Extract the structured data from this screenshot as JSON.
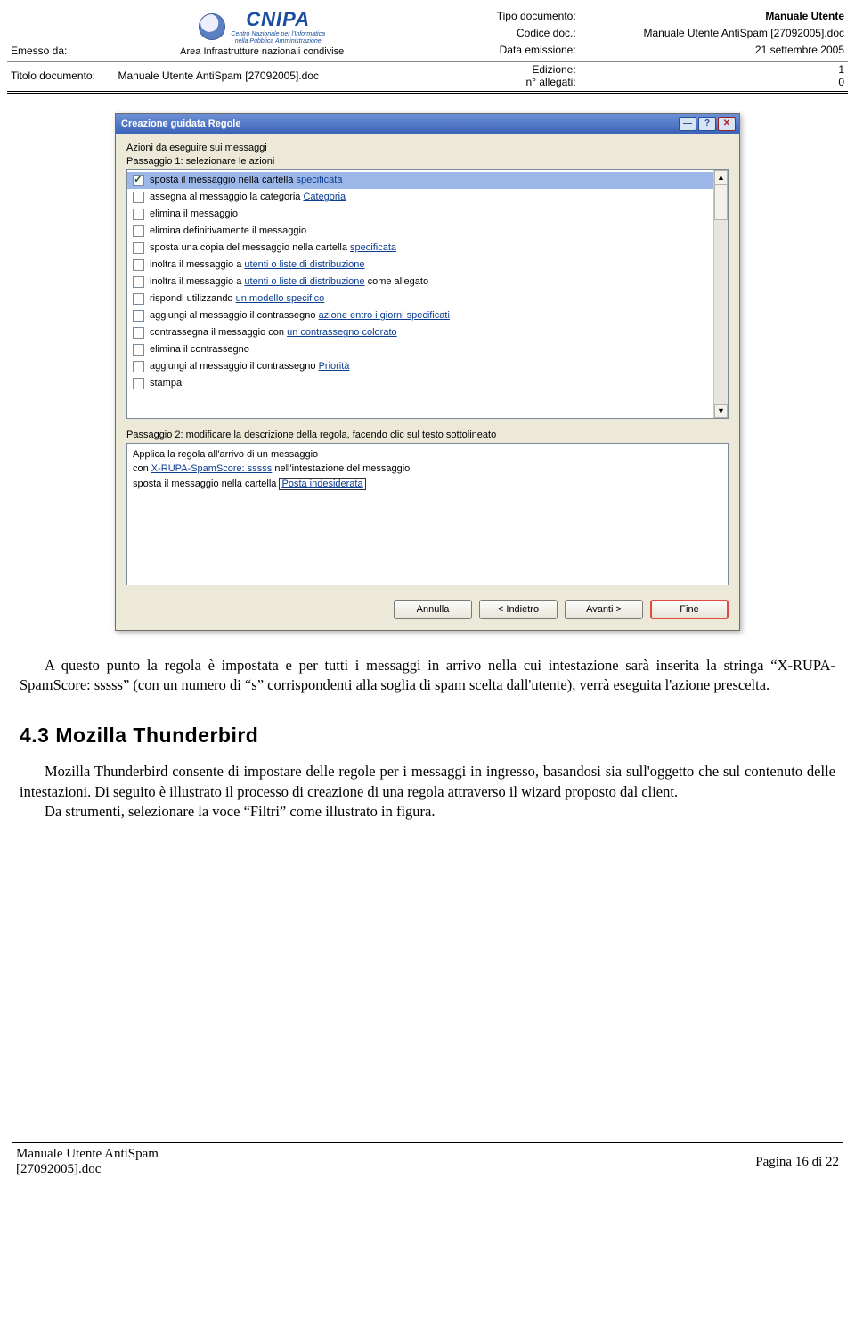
{
  "header": {
    "emesso_label": "Emesso da:",
    "logo_title": "CNIPA",
    "logo_sub1": "Centro Nazionale per l'Informatica",
    "logo_sub2": "nella Pubblica Amministrazione",
    "area_label": "Area Infrastrutture nazionali condivise",
    "tipo_label": "Tipo documento:",
    "codice_label": "Codice doc.:",
    "data_label": "Data emissione:",
    "tipo_value": "Manuale Utente",
    "codice_value": "Manuale Utente AntiSpam [27092005].doc",
    "data_value": "21 settembre 2005",
    "titolo_label": "Titolo documento:",
    "titolo_value": "Manuale Utente AntiSpam [27092005].doc",
    "edizione_label": "Edizione:",
    "allegati_label": "n° allegati:",
    "edizione_value": "1",
    "allegati_value": "0"
  },
  "dialog": {
    "title": "Creazione guidata Regole",
    "section_label": "Azioni da eseguire sui messaggi",
    "step1_label": "Passaggio 1: selezionare le azioni",
    "items": [
      {
        "pre": "sposta il messaggio nella cartella ",
        "link": "specificata",
        "post": "",
        "checked": true,
        "selected": true
      },
      {
        "pre": "assegna al messaggio la categoria ",
        "link": "Categoria",
        "post": "",
        "checked": false
      },
      {
        "pre": "elimina il messaggio",
        "link": "",
        "post": "",
        "checked": false
      },
      {
        "pre": "elimina definitivamente il messaggio",
        "link": "",
        "post": "",
        "checked": false
      },
      {
        "pre": "sposta una copia del messaggio nella cartella ",
        "link": "specificata",
        "post": "",
        "checked": false
      },
      {
        "pre": "inoltra il messaggio a ",
        "link": "utenti o liste di distribuzione",
        "post": "",
        "checked": false
      },
      {
        "pre": "inoltra il messaggio a ",
        "link": "utenti o liste di distribuzione",
        "post": " come allegato",
        "checked": false
      },
      {
        "pre": "rispondi utilizzando ",
        "link": "un modello specifico",
        "post": "",
        "checked": false
      },
      {
        "pre": "aggiungi al messaggio il contrassegno ",
        "link": "azione entro i giorni specificati",
        "post": "",
        "checked": false
      },
      {
        "pre": "contrassegna il messaggio con ",
        "link": "un contrassegno colorato",
        "post": "",
        "checked": false
      },
      {
        "pre": "elimina il contrassegno",
        "link": "",
        "post": "",
        "checked": false
      },
      {
        "pre": "aggiungi al messaggio il contrassegno ",
        "link": "Priorità",
        "post": "",
        "checked": false
      },
      {
        "pre": "stampa",
        "link": "",
        "post": "",
        "checked": false
      }
    ],
    "step2_label": "Passaggio 2: modificare la descrizione della regola, facendo clic sul testo sottolineato",
    "desc_line1": "Applica la regola all'arrivo di un messaggio",
    "desc_line2_pre": "con ",
    "desc_line2_link": "X-RUPA-SpamScore: sssss",
    "desc_line2_post": " nell'intestazione del messaggio",
    "desc_line3_pre": "sposta il messaggio nella cartella ",
    "desc_line3_link": "Posta indesiderata",
    "buttons": {
      "cancel": "Annulla",
      "back": "< Indietro",
      "next": "Avanti >",
      "finish": "Fine"
    }
  },
  "body": {
    "para1": "A questo punto la regola è impostata e per tutti i messaggi in arrivo nella cui intestazione sarà inserita la stringa “X-RUPA-SpamScore: sssss” (con un numero di “s” corrispondenti alla soglia di spam scelta dall'utente), verrà eseguita l'azione prescelta.",
    "heading": "4.3 Mozilla Thunderbird",
    "para2": "Mozilla Thunderbird consente di impostare delle regole per i messaggi in ingresso, basandosi sia sull'oggetto che sul contenuto delle intestazioni. Di seguito è illustrato il processo di creazione di una regola attraverso il wizard proposto dal client.",
    "para3": "Da strumenti, selezionare la voce “Filtri” come illustrato in figura."
  },
  "footer": {
    "left1": "Manuale Utente AntiSpam",
    "left2": "[27092005].doc",
    "right": "Pagina 16 di 22"
  }
}
